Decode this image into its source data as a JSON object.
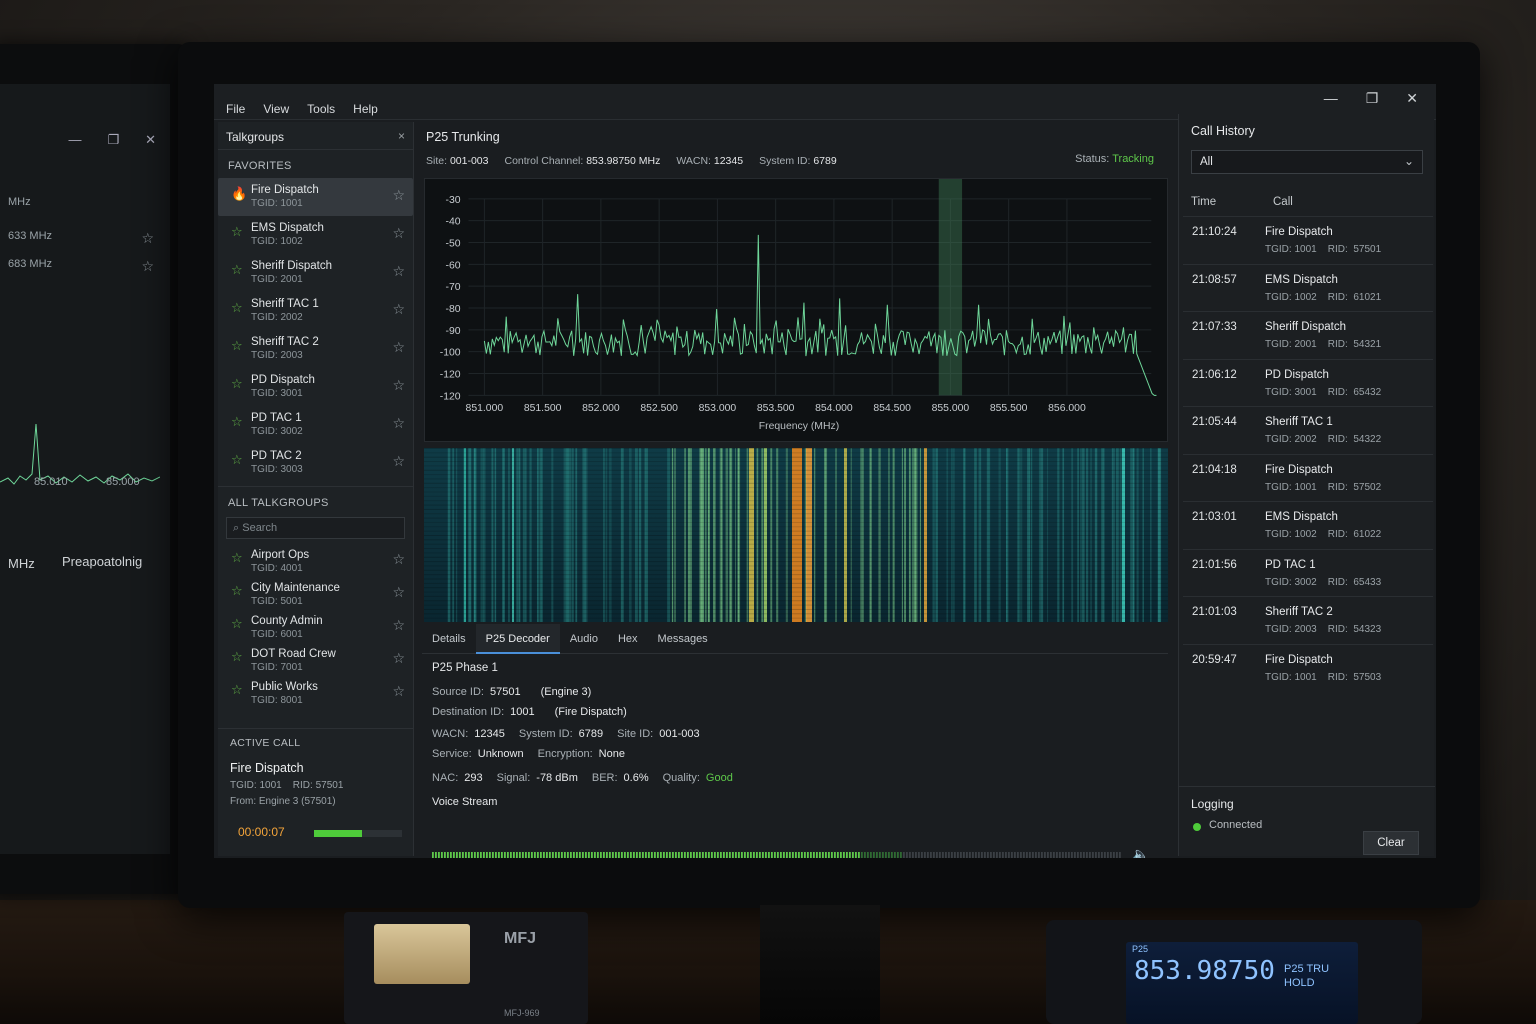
{
  "menu": [
    "File",
    "View",
    "Tools",
    "Help"
  ],
  "window_controls": [
    "—",
    "❐",
    "✕"
  ],
  "left_monitor": {
    "unit": "MHz",
    "freqs": [
      "633 MHz",
      "683 MHz"
    ],
    "ticks": [
      "85.010",
      "85.000"
    ],
    "label": "MHz",
    "heading": "Preapoatolnig"
  },
  "talkgroups": {
    "title": "Talkgroups",
    "close": "×",
    "favorites_label": "FAVORITES",
    "favorites": [
      {
        "name": "Fire Dispatch",
        "tgid": "TGID: 1001",
        "icon": "flame-icon"
      },
      {
        "name": "EMS Dispatch",
        "tgid": "TGID: 1002",
        "icon": "star-icon"
      },
      {
        "name": "Sheriff Dispatch",
        "tgid": "TGID: 2001",
        "icon": "star-icon"
      },
      {
        "name": "Sheriff TAC 1",
        "tgid": "TGID: 2002",
        "icon": "star-icon"
      },
      {
        "name": "Sheriff TAC 2",
        "tgid": "TGID: 2003",
        "icon": "star-icon"
      },
      {
        "name": "PD Dispatch",
        "tgid": "TGID: 3001",
        "icon": "star-icon"
      },
      {
        "name": "PD TAC 1",
        "tgid": "TGID: 3002",
        "icon": "star-icon"
      },
      {
        "name": "PD TAC 2",
        "tgid": "TGID: 3003",
        "icon": "star-icon"
      }
    ],
    "all_label": "ALL TALKGROUPS",
    "search_placeholder": "Search",
    "all": [
      {
        "name": "Airport Ops",
        "tgid": "TGID: 4001"
      },
      {
        "name": "City Maintenance",
        "tgid": "TGID: 5001"
      },
      {
        "name": "County Admin",
        "tgid": "TGID: 6001"
      },
      {
        "name": "DOT Road Crew",
        "tgid": "TGID: 7001"
      },
      {
        "name": "Public Works",
        "tgid": "TGID: 8001"
      }
    ]
  },
  "active_call": {
    "label": "ACTIVE CALL",
    "name": "Fire Dispatch",
    "ids": "TGID: 1001    RID: 57501",
    "from": "From: Engine 3 (57501)",
    "timer": "00:00:07",
    "level": 0.55
  },
  "trunking": {
    "title": "P25 Trunking",
    "site_label": "Site:",
    "site": "001-003",
    "cc_label": "Control Channel:",
    "cc": "853.98750 MHz",
    "wacn_label": "WACN:",
    "wacn": "12345",
    "sys_label": "System  ID:",
    "sys": "6789",
    "status_label": "Status:",
    "status": "Tracking",
    "status_color": "#5ec84a"
  },
  "chart_data": {
    "type": "line",
    "xlabel": "Frequency (MHz)",
    "ylabel": "",
    "x_ticks": [
      "851.000",
      "851.500",
      "852.000",
      "852.500",
      "853.000",
      "853.500",
      "854.000",
      "854.500",
      "855.000",
      "855.500",
      "856.000"
    ],
    "y_ticks": [
      "-30",
      "-40",
      "-50",
      "-60",
      "-70",
      "-80",
      "-90",
      "-100",
      "-120",
      "-120"
    ],
    "xlim": [
      850.95,
      856.75
    ],
    "noise_floor": -97,
    "selected_band": [
      854.9,
      855.1
    ],
    "peaks": [
      {
        "x": 851.8,
        "y": -75
      },
      {
        "x": 852.2,
        "y": -87
      },
      {
        "x": 853.0,
        "y": -82
      },
      {
        "x": 853.35,
        "y": -47
      },
      {
        "x": 853.7,
        "y": -86
      },
      {
        "x": 853.75,
        "y": -79
      },
      {
        "x": 854.05,
        "y": -77
      },
      {
        "x": 854.35,
        "y": -89
      },
      {
        "x": 854.45,
        "y": -80
      },
      {
        "x": 855.25,
        "y": -80
      }
    ],
    "series": [
      {
        "values": [],
        "color": "#6fd79a"
      }
    ]
  },
  "tabs": [
    "Details",
    "P25 Decoder",
    "Audio",
    "Hex",
    "Messages"
  ],
  "decoder": {
    "phase": "P25 Phase 1",
    "source_label": "Source ID:",
    "source": "57501",
    "source_note": "(Engine 3)",
    "dest_label": "Destination ID:",
    "dest": "1001",
    "dest_note": "(Fire Dispatch)",
    "wacn_label": "WACN:",
    "wacn": "12345",
    "sys_label": "System ID:",
    "sys": "6789",
    "site_label": "Site ID:",
    "site": "001-003",
    "service_label": "Service:",
    "service": "Unknown",
    "enc_label": "Encryption:",
    "enc": "None",
    "nac_label": "NAC:",
    "nac": "293",
    "signal_label": "Signal:",
    "signal": "-78 dBm",
    "ber_label": "BER:",
    "ber": "0.6%",
    "quality_label": "Quality:",
    "quality": "Good",
    "voice_label": "Voice Stream",
    "voice_level": 0.62
  },
  "history": {
    "title": "Call History",
    "filter": "All",
    "col_time": "Time",
    "col_call": "Call",
    "rows": [
      {
        "time": "21:10:24",
        "call": "Fire Dispatch",
        "detail": "TGID: 1001    RID:  57501"
      },
      {
        "time": "21:08:57",
        "call": "EMS Dispatch",
        "detail": "TGID: 1002    RID:  61021"
      },
      {
        "time": "21:07:33",
        "call": "Sheriff Dispatch",
        "detail": "TGID: 2001    RID:  54321"
      },
      {
        "time": "21:06:12",
        "call": "PD Dispatch",
        "detail": "TGID: 3001    RID:  65432"
      },
      {
        "time": "21:05:44",
        "call": "Sheriff TAC 1",
        "detail": "TGID: 2002    RID:  54322"
      },
      {
        "time": "21:04:18",
        "call": "Fire Dispatch",
        "detail": "TGID: 1001    RID:  57502"
      },
      {
        "time": "21:03:01",
        "call": "EMS Dispatch",
        "detail": "TGID: 1002    RID:  61022"
      },
      {
        "time": "21:01:56",
        "call": "PD TAC 1",
        "detail": "TGID: 3002    RID:  65433"
      },
      {
        "time": "21:01:03",
        "call": "Sheriff TAC 2",
        "detail": "TGID: 2003    RID:  54323"
      },
      {
        "time": "20:59:47",
        "call": "Fire Dispatch",
        "detail": "TGID: 1001    RID:  57503"
      }
    ],
    "logging_label": "Logging",
    "logging_status": "Connected",
    "clear": "Clear"
  },
  "desk": {
    "meter_brand": "MFJ",
    "meter_model": "MFJ-969",
    "radio_mode": "P25",
    "radio_freq": "853.98750",
    "radio_tag": "P25",
    "radio_status1": "TRU",
    "radio_status2": "HOLD"
  }
}
